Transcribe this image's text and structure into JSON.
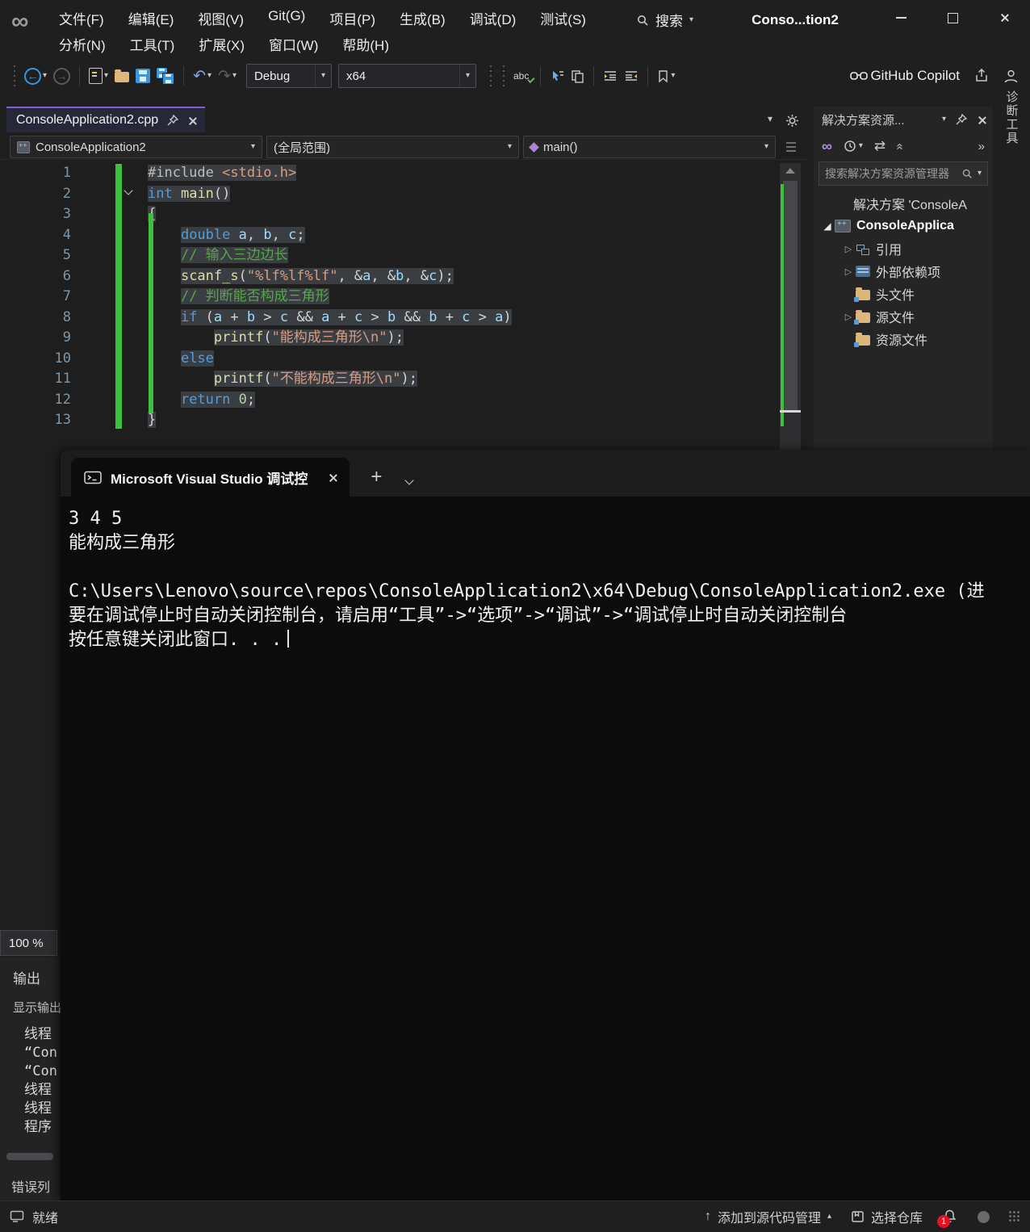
{
  "titlebar": {
    "title": "Conso...tion2",
    "search_label": "搜索",
    "menus_row1": [
      "文件(F)",
      "编辑(E)",
      "视图(V)",
      "Git(G)",
      "项目(P)",
      "生成(B)",
      "调试(D)",
      "测试(S)"
    ],
    "menus_row2": [
      "分析(N)",
      "工具(T)",
      "扩展(X)",
      "窗口(W)",
      "帮助(H)"
    ]
  },
  "toolbar": {
    "debug": "Debug",
    "platform": "x64",
    "copilot": "GitHub Copilot"
  },
  "editor": {
    "tab_title": "ConsoleApplication2.cpp",
    "nav_project": "ConsoleApplication2",
    "nav_scope": "(全局范围)",
    "nav_member": "main()",
    "zoom": "100 %",
    "code": [
      {
        "num": 1,
        "ws": "",
        "tokens": [
          [
            "pp",
            "#include "
          ],
          [
            "st",
            "<stdio.h>"
          ]
        ]
      },
      {
        "num": 2,
        "ws": "",
        "tokens": [
          [
            "kw",
            "int"
          ],
          [
            "pl",
            " "
          ],
          [
            "fn",
            "main"
          ],
          [
            "pl",
            "()"
          ]
        ]
      },
      {
        "num": 3,
        "ws": "",
        "tokens": [
          [
            "pl",
            "{"
          ]
        ]
      },
      {
        "num": 4,
        "ws": "    ",
        "tokens": [
          [
            "kw",
            "double"
          ],
          [
            "pl",
            " "
          ],
          [
            "vr",
            "a"
          ],
          [
            "pl",
            ", "
          ],
          [
            "vr",
            "b"
          ],
          [
            "pl",
            ", "
          ],
          [
            "vr",
            "c"
          ],
          [
            "pl",
            ";"
          ]
        ]
      },
      {
        "num": 5,
        "ws": "    ",
        "tokens": [
          [
            "cm",
            "// 输入三边边长"
          ]
        ]
      },
      {
        "num": 6,
        "ws": "    ",
        "tokens": [
          [
            "fn",
            "scanf_s"
          ],
          [
            "pl",
            "("
          ],
          [
            "st",
            "\"%lf%lf%lf\""
          ],
          [
            "pl",
            ", &"
          ],
          [
            "vr",
            "a"
          ],
          [
            "pl",
            ", &"
          ],
          [
            "vr",
            "b"
          ],
          [
            "pl",
            ", &"
          ],
          [
            "vr",
            "c"
          ],
          [
            "pl",
            ");"
          ]
        ]
      },
      {
        "num": 7,
        "ws": "    ",
        "tokens": [
          [
            "cm",
            "// 判断能否构成三角形"
          ]
        ]
      },
      {
        "num": 8,
        "ws": "    ",
        "tokens": [
          [
            "kw",
            "if"
          ],
          [
            "pl",
            " ("
          ],
          [
            "vr",
            "a"
          ],
          [
            "pl",
            " + "
          ],
          [
            "vr",
            "b"
          ],
          [
            "pl",
            " > "
          ],
          [
            "vr",
            "c"
          ],
          [
            "pl",
            " && "
          ],
          [
            "vr",
            "a"
          ],
          [
            "pl",
            " + "
          ],
          [
            "vr",
            "c"
          ],
          [
            "pl",
            " > "
          ],
          [
            "vr",
            "b"
          ],
          [
            "pl",
            " && "
          ],
          [
            "vr",
            "b"
          ],
          [
            "pl",
            " + "
          ],
          [
            "vr",
            "c"
          ],
          [
            "pl",
            " > "
          ],
          [
            "vr",
            "a"
          ],
          [
            "pl",
            ")"
          ]
        ]
      },
      {
        "num": 9,
        "ws": "        ",
        "tokens": [
          [
            "fn",
            "printf"
          ],
          [
            "pl",
            "("
          ],
          [
            "st",
            "\"能构成三角形\\n\""
          ],
          [
            "pl",
            ");"
          ]
        ]
      },
      {
        "num": 10,
        "ws": "    ",
        "tokens": [
          [
            "kw",
            "else"
          ]
        ]
      },
      {
        "num": 11,
        "ws": "        ",
        "tokens": [
          [
            "fn",
            "printf"
          ],
          [
            "pl",
            "("
          ],
          [
            "st",
            "\"不能构成三角形\\n\""
          ],
          [
            "pl",
            ");"
          ]
        ]
      },
      {
        "num": 12,
        "ws": "    ",
        "tokens": [
          [
            "kw",
            "return"
          ],
          [
            "pl",
            " "
          ],
          [
            "nm",
            "0"
          ],
          [
            "pl",
            ";"
          ]
        ]
      },
      {
        "num": 13,
        "ws": "",
        "tokens": [
          [
            "pl",
            "}"
          ]
        ]
      }
    ]
  },
  "solution_explorer": {
    "title": "解决方案资源...",
    "search_placeholder": "搜索解决方案资源管理器",
    "items": [
      {
        "label": "解决方案 'ConsoleA",
        "icon": "solution",
        "indent": 0,
        "arrow": "none",
        "bold": false
      },
      {
        "label": "ConsoleApplica",
        "icon": "cpp-project",
        "indent": 0,
        "arrow": "expanded",
        "bold": true
      },
      {
        "label": "引用",
        "icon": "references",
        "indent": 1,
        "arrow": "collapsed",
        "bold": false
      },
      {
        "label": "外部依赖项",
        "icon": "dependencies",
        "indent": 1,
        "arrow": "collapsed",
        "bold": false
      },
      {
        "label": "头文件",
        "icon": "folder",
        "indent": 1,
        "arrow": "none",
        "bold": false
      },
      {
        "label": "源文件",
        "icon": "folder",
        "indent": 1,
        "arrow": "collapsed",
        "bold": false
      },
      {
        "label": "资源文件",
        "icon": "folder",
        "indent": 1,
        "arrow": "none",
        "bold": false
      }
    ]
  },
  "diagnostics_tab": "诊断工具",
  "console": {
    "tab_title": "Microsoft Visual Studio 调试控",
    "lines": [
      "3 4 5",
      "能构成三角形",
      "",
      "C:\\Users\\Lenovo\\source\\repos\\ConsoleApplication2\\x64\\Debug\\ConsoleApplication2.exe (进",
      "要在调试停止时自动关闭控制台，请启用“工具”->“选项”->“调试”->“调试停止时自动关闭控制台",
      "按任意键关闭此窗口. . ."
    ]
  },
  "output_panel": {
    "title": "输出",
    "source_label": "显示输出",
    "lines": [
      "线程",
      "“Con",
      "“Con",
      "线程",
      "线程",
      "程序"
    ],
    "bottom_tab": "错误列"
  },
  "statusbar": {
    "ready": "就绪",
    "add_scc": "添加到源代码管理",
    "select_repo": "选择仓库",
    "badge": "1"
  },
  "icons": {
    "caret_down": "▾",
    "caret_up": "▴",
    "tree_collapsed": "▷",
    "tree_expanded": "◢",
    "back_arrow": "←",
    "forward_arrow": "→",
    "undo_arrow": "↶",
    "redo_arrow": "↷",
    "sync": "⇄",
    "collapse_all": "«",
    "overflow": "»",
    "up_arrow": "↑",
    "plus": "+",
    "infinity": "∞",
    "abc": "abc"
  }
}
